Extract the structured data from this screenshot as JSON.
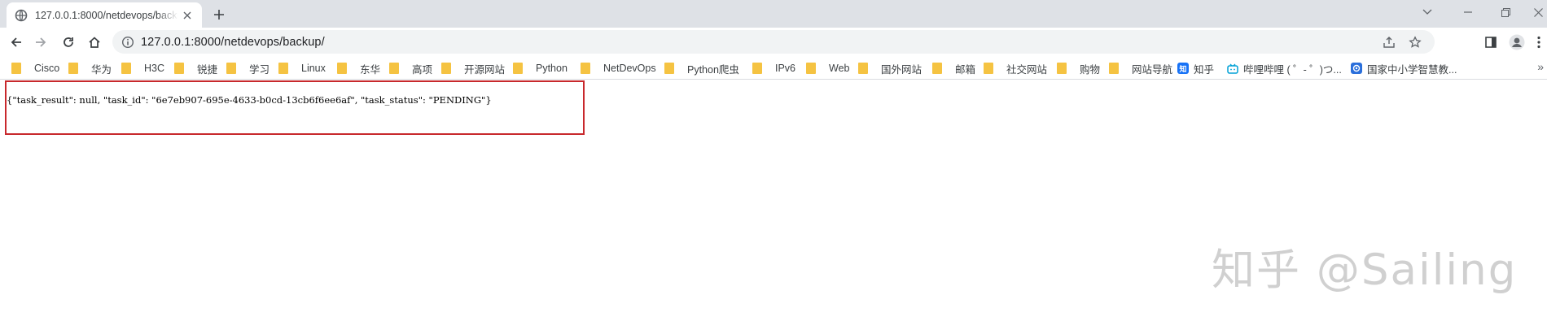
{
  "tab": {
    "title": "127.0.0.1:8000/netdevops/backup/"
  },
  "omnibox": {
    "url": "127.0.0.1:8000/netdevops/backup/"
  },
  "bookmarks": [
    {
      "label": "Cisco",
      "type": "folder"
    },
    {
      "label": "华为",
      "type": "folder"
    },
    {
      "label": "H3C",
      "type": "folder"
    },
    {
      "label": "锐捷",
      "type": "folder"
    },
    {
      "label": "学习",
      "type": "folder"
    },
    {
      "label": "Linux",
      "type": "folder"
    },
    {
      "label": "东华",
      "type": "folder"
    },
    {
      "label": "高项",
      "type": "folder"
    },
    {
      "label": "开源网站",
      "type": "folder"
    },
    {
      "label": "Python",
      "type": "folder"
    },
    {
      "label": "NetDevOps",
      "type": "folder"
    },
    {
      "label": "Python爬虫",
      "type": "folder"
    },
    {
      "label": "IPv6",
      "type": "folder"
    },
    {
      "label": "Web",
      "type": "folder"
    },
    {
      "label": "国外网站",
      "type": "folder"
    },
    {
      "label": "邮箱",
      "type": "folder"
    },
    {
      "label": "社交网站",
      "type": "folder"
    },
    {
      "label": "购物",
      "type": "folder"
    },
    {
      "label": "网站导航",
      "type": "folder"
    },
    {
      "label": "知乎",
      "type": "zhihu",
      "icon_text": "知"
    },
    {
      "label": "哔哩哔哩 ( ゜- ゜)つ...",
      "type": "bilibili"
    },
    {
      "label": "国家中小学智慧教...",
      "type": "edu"
    }
  ],
  "bookmarks_more": "»",
  "content": {
    "json_text": "{\"task_result\": null, \"task_id\": \"6e7eb907-695e-4633-b0cd-13cb6f6ee6af\", \"task_status\": \"PENDING\"}"
  },
  "watermark": "知乎 @Sailing",
  "colors": {
    "folder": "#f5c342",
    "highlight_border": "#c8282c",
    "zhihu": "#1772f6",
    "bilibili": "#00a1d6",
    "edu": "#2a6fdb"
  }
}
